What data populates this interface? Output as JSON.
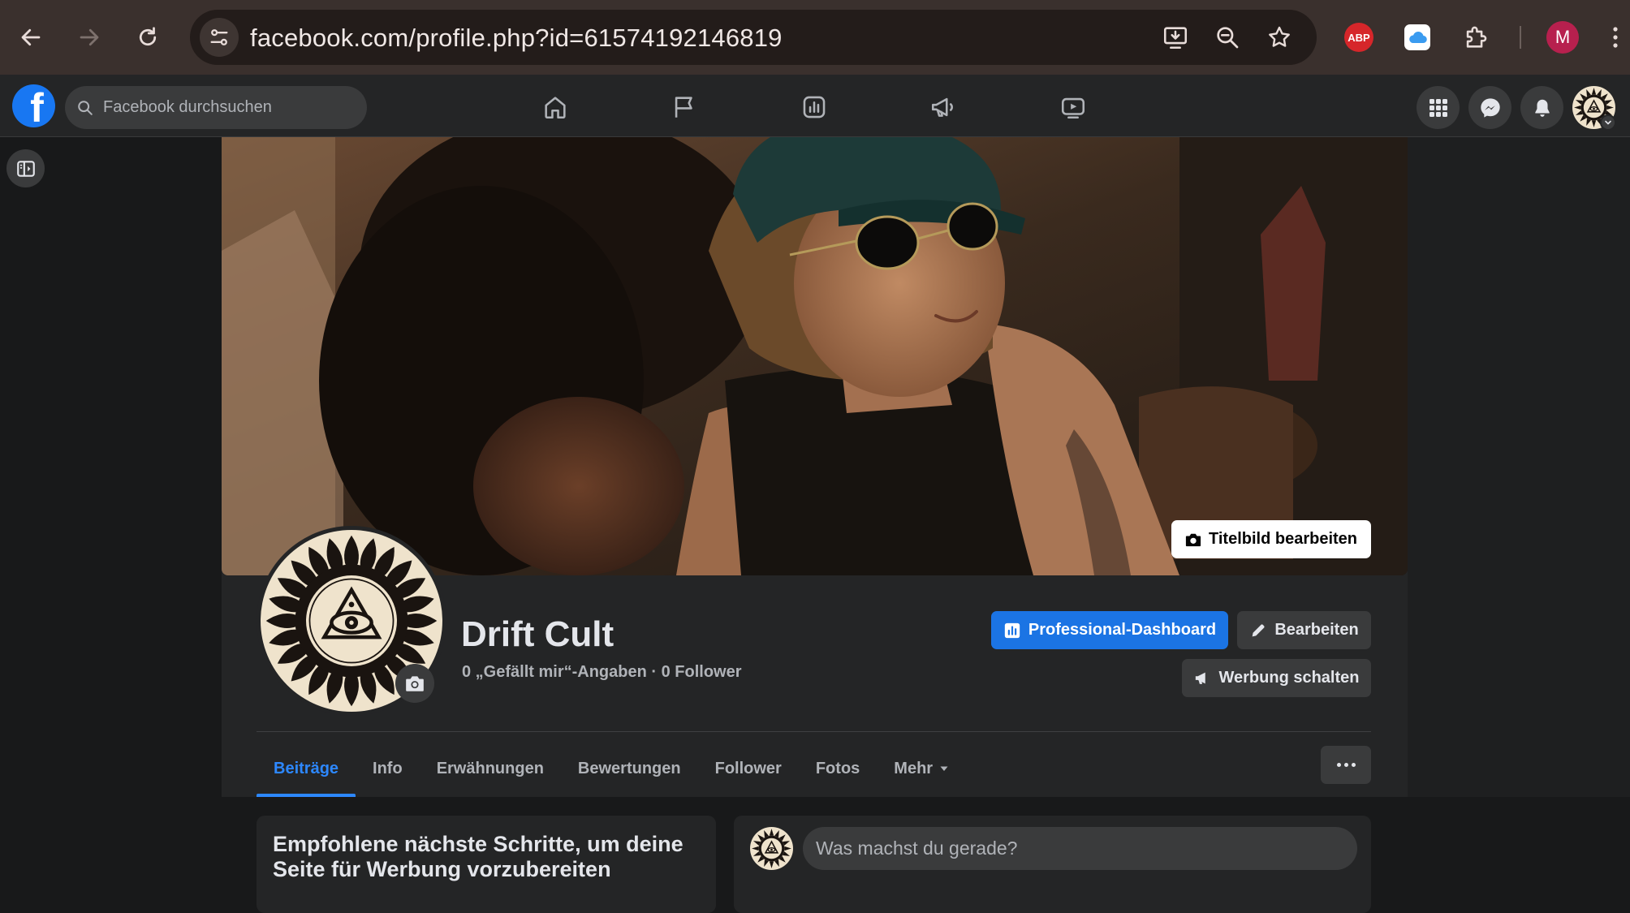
{
  "browser": {
    "url": "facebook.com/profile.php?id=61574192146819",
    "abp_label": "ABP",
    "profile_initial": "M"
  },
  "fb_header": {
    "search_placeholder": "Facebook durchsuchen",
    "logo_letter": "f",
    "nav_icons": [
      "home-icon",
      "flag-icon",
      "insights-icon",
      "megaphone-icon",
      "video-icon"
    ],
    "right_icons": [
      "menu-grid-icon",
      "messenger-icon",
      "notifications-icon"
    ]
  },
  "cover": {
    "edit_label": "Titelbild bearbeiten"
  },
  "profile": {
    "name": "Drift Cult",
    "stats": "0 „Gefällt mir“-Angaben · 0 Follower"
  },
  "actions": {
    "dashboard": "Professional-Dashboard",
    "edit": "Bearbeiten",
    "ads": "Werbung schalten"
  },
  "tabs": [
    {
      "label": "Beiträge",
      "active": true
    },
    {
      "label": "Info"
    },
    {
      "label": "Erwähnungen"
    },
    {
      "label": "Bewertungen"
    },
    {
      "label": "Follower"
    },
    {
      "label": "Fotos"
    },
    {
      "label": "Mehr"
    }
  ],
  "cards": {
    "left_title": "Empfohlene nächste Schritte, um deine Seite für Werbung vorzubereiten",
    "composer_placeholder": "Was machst du gerade?"
  },
  "colors": {
    "brand": "#1877f2",
    "active_tab": "#2d88ff",
    "surface": "#242526"
  }
}
